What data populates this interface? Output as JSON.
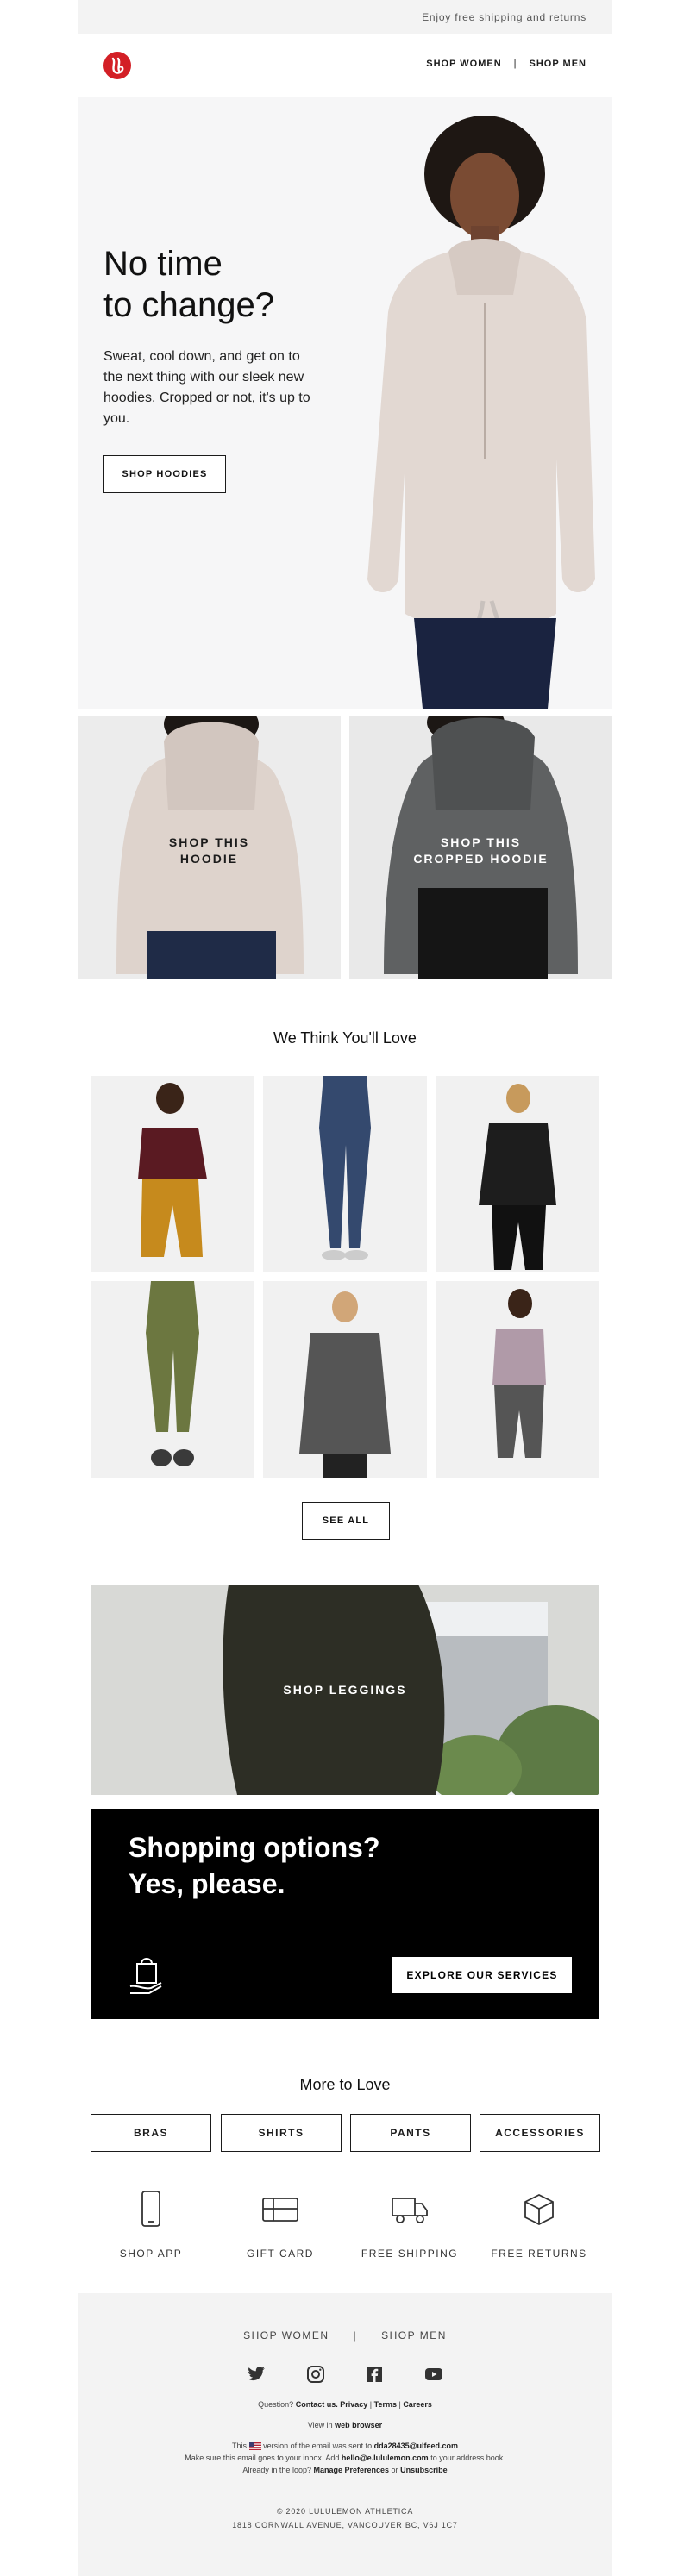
{
  "topbar": {
    "promo": "Enjoy free shipping and returns"
  },
  "header": {
    "logo": "lululemon-logo",
    "nav": {
      "women": "SHOP WOMEN",
      "separator": "|",
      "men": "SHOP MEN"
    }
  },
  "hero": {
    "title_line1": "No time",
    "title_line2": "to change?",
    "body": "Sweat, cool down, and get on to the next thing with our sleek new hoodies. Cropped or not, it's up to you.",
    "cta": "SHOP HOODIES"
  },
  "tiles": [
    {
      "line1": "SHOP THIS",
      "line2": "HOODIE"
    },
    {
      "line1": "SHOP THIS",
      "line2": "CROPPED HOODIE"
    }
  ],
  "recommendations": {
    "title": "We Think You'll Love",
    "cta": "SEE ALL"
  },
  "leggings": {
    "label": "SHOP LEGGINGS"
  },
  "services": {
    "line1": "Shopping options?",
    "line2": "Yes, please.",
    "cta": "EXPLORE OUR SERVICES",
    "icon": "shopping-bag-hand-icon"
  },
  "more": {
    "title": "More to Love",
    "categories": [
      "BRAS",
      "SHIRTS",
      "PANTS",
      "ACCESSORIES"
    ],
    "features": [
      {
        "label": "SHOP APP",
        "icon": "phone-icon"
      },
      {
        "label": "GIFT CARD",
        "icon": "gift-card-icon"
      },
      {
        "label": "FREE SHIPPING",
        "icon": "truck-icon"
      },
      {
        "label": "FREE RETURNS",
        "icon": "box-icon"
      }
    ]
  },
  "footer": {
    "nav": {
      "women": "SHOP WOMEN",
      "separator": "|",
      "men": "SHOP MEN"
    },
    "social": [
      "twitter-icon",
      "instagram-icon",
      "facebook-icon",
      "youtube-icon"
    ],
    "question_prefix": "Question?",
    "contact": "Contact us.",
    "privacy": "Privacy",
    "terms": "Terms",
    "careers": "Careers",
    "view_in_prefix": "View in",
    "web_browser": "web browser",
    "sent_prefix": "This",
    "sent_mid": "version of the email was sent to",
    "email": "dda28435@ulfeed.com",
    "inbox_prefix": "Make sure this email goes to your inbox. Add",
    "sender": "hello@e.lululemon.com",
    "inbox_suffix": "to your address book.",
    "loop_prefix": "Already in the loop?",
    "manage": "Manage Preferences",
    "or": "or",
    "unsubscribe": "Unsubscribe",
    "copyright": "© 2020 LULULEMON ATHLETICA",
    "address": "1818 CORNWALL AVENUE, VANCOUVER BC, V6J 1C7"
  }
}
